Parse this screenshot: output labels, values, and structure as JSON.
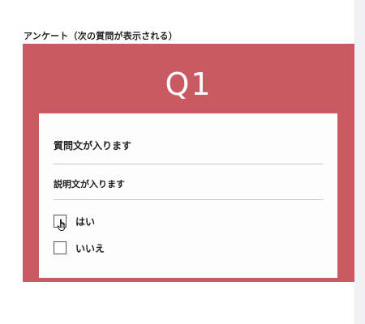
{
  "page": {
    "heading": "アンケート（次の質問が表示される）"
  },
  "survey": {
    "question_number": "Q1",
    "question_text": "質問文が入ります",
    "description_text": "説明文が入ります",
    "options": [
      {
        "label": "はい",
        "checked": false
      },
      {
        "label": "いいえ",
        "checked": false
      }
    ]
  },
  "colors": {
    "panel_background": "#c95a63",
    "card_background": "#fefdfd",
    "question_number_text": "#ffffff"
  },
  "icons": {
    "cursor": "hand-pointer-icon"
  }
}
